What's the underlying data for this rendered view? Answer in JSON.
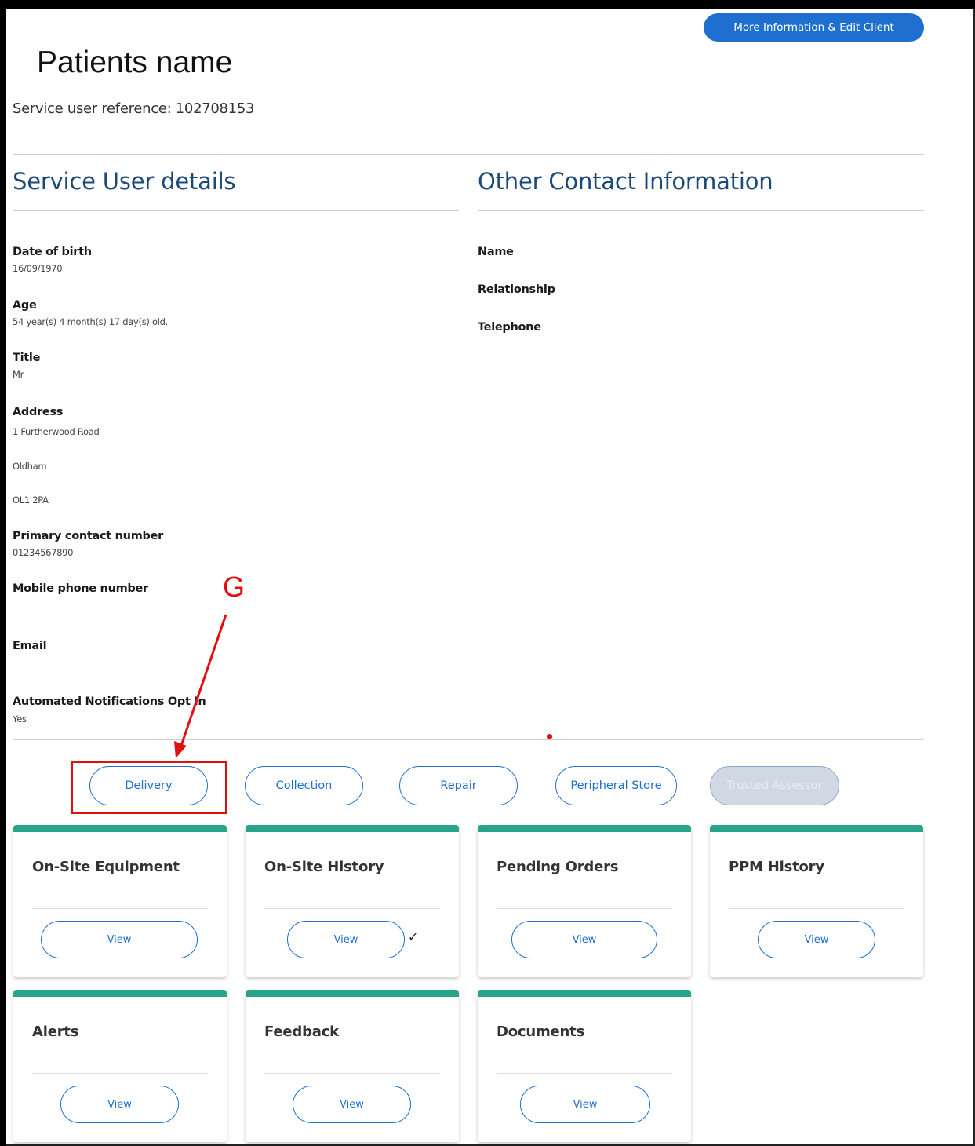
{
  "header": {
    "more_info_button": "More Information & Edit Client",
    "patient_name": "Patients name",
    "service_user_reference": "Service user reference: 102708153"
  },
  "service_user_details": {
    "heading": "Service User details",
    "fields": {
      "dob_label": "Date of birth",
      "dob_value": "16/09/1970",
      "age_label": "Age",
      "age_value": "54 year(s) 4 month(s) 17 day(s) old.",
      "title_label": "Title",
      "title_value": "Mr",
      "address_label": "Address",
      "address_line1": "1 Furtherwood Road",
      "address_line2": "Oldham",
      "address_line3": "OL1 2PA",
      "primary_label": "Primary contact number",
      "primary_value": "01234567890",
      "mobile_label": "Mobile phone number",
      "email_label": "Email",
      "notifications_label": "Automated Notifications Opt In",
      "notifications_value": "Yes"
    }
  },
  "other_contact": {
    "heading": "Other Contact Information",
    "name_label": "Name",
    "relationship_label": "Relationship",
    "telephone_label": "Telephone"
  },
  "annotation": {
    "letter": "G",
    "color": "#e01010"
  },
  "actions": {
    "delivery": "Delivery",
    "collection": "Collection",
    "repair": "Repair",
    "peripheral_store": "Peripheral Store",
    "trusted_assessor": "Trusted Assessor"
  },
  "cards": {
    "onsite_equipment": {
      "title": "On-Site Equipment",
      "button": "View"
    },
    "onsite_history": {
      "title": "On-Site History",
      "button": "View",
      "check": "✓"
    },
    "pending_orders": {
      "title": "Pending Orders",
      "button": "View"
    },
    "ppm_history": {
      "title": "PPM History",
      "button": "View"
    },
    "alerts": {
      "title": "Alerts",
      "button": "View"
    },
    "feedback": {
      "title": "Feedback",
      "button": "View"
    },
    "documents": {
      "title": "Documents",
      "button": "View"
    }
  },
  "colors": {
    "accent": "#1f6fd1",
    "card_top": "#2aa38b",
    "heading": "#1c4a78",
    "annotation": "#e01010"
  }
}
